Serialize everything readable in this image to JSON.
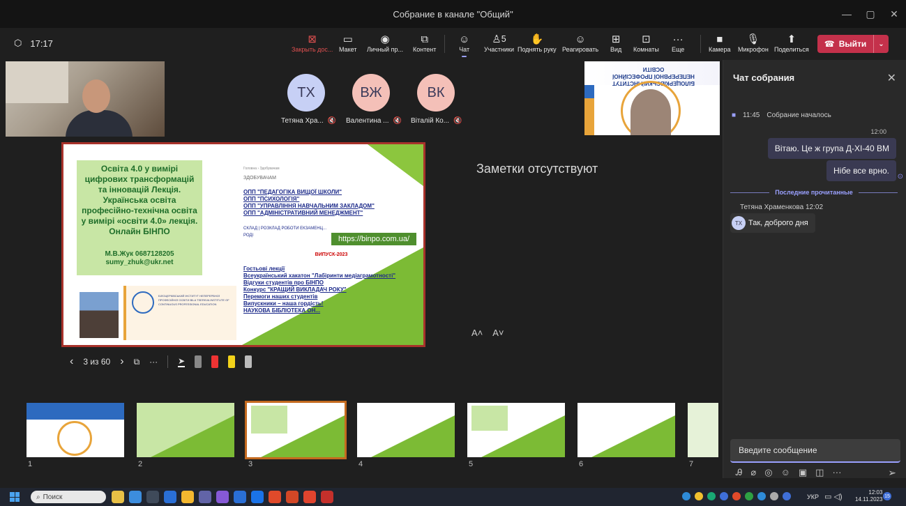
{
  "window": {
    "title": "Собрание в канале \"Общий\""
  },
  "toolbar": {
    "timer": "17:17",
    "buttons": [
      {
        "label": "Закрыть дос...",
        "icon": "close-box-icon"
      },
      {
        "label": "Макет",
        "icon": "layout-icon"
      },
      {
        "label": "Личный пр...",
        "icon": "eye-icon"
      },
      {
        "label": "Контент",
        "icon": "share-content-icon"
      },
      {
        "label": "Чат",
        "icon": "chat-icon"
      },
      {
        "label": "Участники",
        "icon": "people-icon",
        "badge": "5"
      },
      {
        "label": "Поднять руку",
        "icon": "hand-icon"
      },
      {
        "label": "Реагировать",
        "icon": "smile-icon"
      },
      {
        "label": "Вид",
        "icon": "view-icon"
      },
      {
        "label": "Комнаты",
        "icon": "rooms-icon"
      },
      {
        "label": "Еще",
        "icon": "more-icon"
      },
      {
        "label": "Камера",
        "icon": "camera-icon"
      },
      {
        "label": "Микрофон",
        "icon": "mic-icon"
      },
      {
        "label": "Поделиться",
        "icon": "share-icon"
      }
    ],
    "leave": "Выйти"
  },
  "participants": [
    {
      "initials": "ТХ",
      "name": "Тетяна Хра...",
      "color": "#c7d0f5"
    },
    {
      "initials": "ВЖ",
      "name": "Валентина ...",
      "color": "#f4c0b8"
    },
    {
      "initials": "ВК",
      "name": "Віталій Ко...",
      "color": "#f4c0b8"
    }
  ],
  "presenter_slide": {
    "title": "БІЛОЦЕРКІВСЬКИЙ ІНСТИТУТ НЕПЕРЕРВНОЇ ПРОФЕСІЙНОЇ ОСВІТИ"
  },
  "slide": {
    "greenbox": "Освіта 4.0 у вимірі цифрових трансформацій та інновацій Лекція. Українська освіта професійно-технічна освіта у вимірі «освіти 4.0» лекція. Онлайн БІНПО",
    "author": "М.В.Жук 0687128205",
    "email": "sumy_zhuk@ukr.net",
    "kicker": "Головна › Здобувачам",
    "section": "ЗДОБУВАЧАМ",
    "links1": [
      "ОПП \"ПЕДАГОГІКА ВИЩОЇ ШКОЛИ\"",
      "ОПП \"ПСИХОЛОГІЯ\"",
      "ОПП \"УПРАВЛІННЯ НАВЧАЛЬНИМ ЗАКЛАДОМ\"",
      "ОПП \"АДМІНІСТРАТИВНИЙ МЕНЕДЖМЕНТ\""
    ],
    "schedule": "СКЛАД | РОЗКЛАД РОБОТИ ЕКЗАМЕНЦ... РОДІ",
    "url": "https://binpo.com.ua/",
    "graduation": "ВИПУСК-2023",
    "links2": [
      "Гостьові лекції",
      "Всеукраїнський хакатон \"Лабіринти медіаграмотності\"",
      "Відгуки студентів про БІНПО",
      "Конкурс \"КРАЩИЙ ВИКЛАДАЧ РОКУ\"",
      "Перемоги наших студентів",
      "Випускники – наша гордість!",
      "НАУКОВА БІБЛІОТЕКА ОН..."
    ],
    "logo_text": "БІЛОЦЕРКІВСЬКИЙ ІНСТИТУТ НЕПЕРЕРВНОЇ ПРОФЕСІЙНОЇ ОСВІТИ BILA TSERKVA INSTITUTE OF CONTINUOUS PROFESSIONAL EDUCATION"
  },
  "notes": "Заметки отсутствуют",
  "font_controls": {
    "increase": "A˄",
    "decrease": "A˅"
  },
  "slide_nav": {
    "counter": "3 из 60"
  },
  "thumbnails": [
    "1",
    "2",
    "3",
    "4",
    "5",
    "6",
    "7"
  ],
  "chat": {
    "title": "Чат собрания",
    "system": {
      "time": "11:45",
      "text": "Собрание началось"
    },
    "out_time": "12:00",
    "out_msgs": [
      "Вітаю. Це ж група Д-ХІ-40 ВМ",
      "Нібе все врно."
    ],
    "read_marker": "Последние прочитанные",
    "in_sender": "Тетяна Храменкова  12:02",
    "in_initials": "ТХ",
    "in_msg": "Так, доброго дня",
    "input_placeholder": "Введите сообщение"
  },
  "taskbar": {
    "search": "Поиск",
    "lang": "УКР",
    "time": "12:03",
    "date": "14.11.2023",
    "notif": "15"
  }
}
